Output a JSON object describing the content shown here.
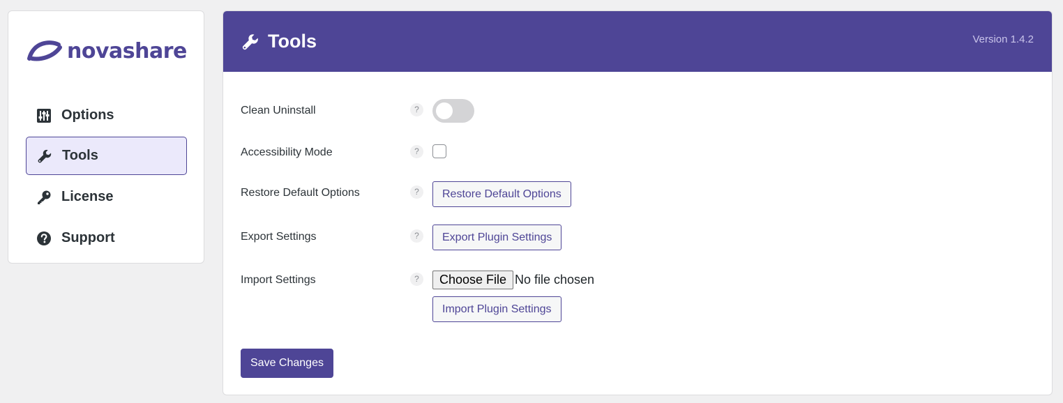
{
  "colors": {
    "brand": "#4e4596",
    "active_nav_bg": "#ebe9fb",
    "page_bg": "#f0f0f1"
  },
  "logo": {
    "text": "novashare",
    "icon": "novashare-logo-icon"
  },
  "sidebar": {
    "items": [
      {
        "label": "Options",
        "icon": "sliders-icon",
        "active": false
      },
      {
        "label": "Tools",
        "icon": "wrench-icon",
        "active": true
      },
      {
        "label": "License",
        "icon": "key-icon",
        "active": false
      },
      {
        "label": "Support",
        "icon": "question-circle-icon",
        "active": false
      }
    ]
  },
  "header": {
    "title": "Tools",
    "icon": "wrench-icon",
    "version": "Version 1.4.2"
  },
  "settings": {
    "help_glyph": "?",
    "clean_uninstall": {
      "label": "Clean Uninstall",
      "enabled": false
    },
    "accessibility_mode": {
      "label": "Accessibility Mode",
      "checked": false
    },
    "restore_defaults": {
      "label": "Restore Default Options",
      "button": "Restore Default Options"
    },
    "export_settings": {
      "label": "Export Settings",
      "button": "Export Plugin Settings"
    },
    "import_settings": {
      "label": "Import Settings",
      "choose_file": "Choose File",
      "file_status": "No file chosen",
      "button": "Import Plugin Settings"
    }
  },
  "save_button": "Save Changes"
}
